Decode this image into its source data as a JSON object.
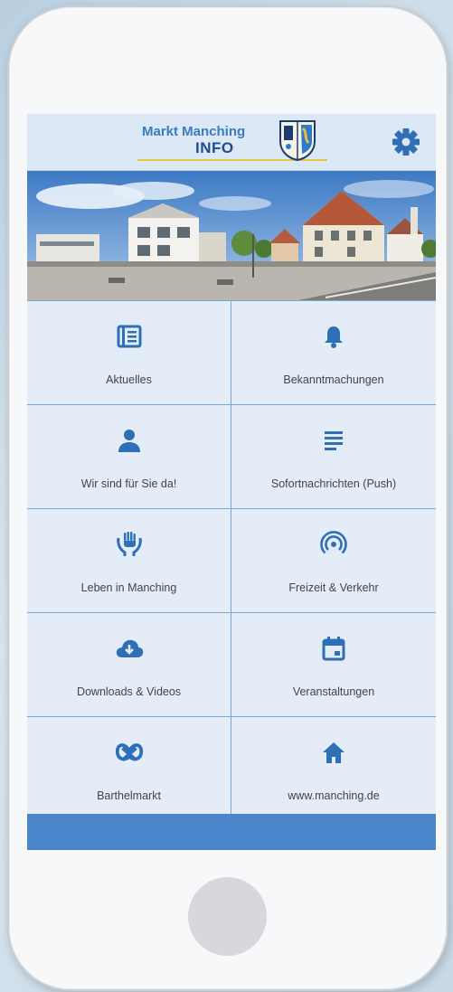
{
  "app": {
    "logo_line1": "Markt Manching",
    "logo_line2": "INFO"
  },
  "icons": {
    "settings": "gear-icon",
    "crest": "coat-of-arms-icon"
  },
  "colors": {
    "accent": "#2f6fb6",
    "tile_bg": "#e3ecf7",
    "divider": "#7aa6d3",
    "footer": "#4a86c9",
    "logo_underline": "#e2c64a"
  },
  "menu": [
    {
      "label": "Aktuelles",
      "icon": "newspaper-icon"
    },
    {
      "label": "Bekanntmachungen",
      "icon": "bell-icon"
    },
    {
      "label": "Wir sind für Sie da!",
      "icon": "person-icon"
    },
    {
      "label": "Sofortnachrichten (Push)",
      "icon": "text-lines-icon"
    },
    {
      "label": "Leben in Manching",
      "icon": "helping-hands-icon"
    },
    {
      "label": "Freizeit & Verkehr",
      "icon": "broadcast-icon"
    },
    {
      "label": "Downloads & Videos",
      "icon": "cloud-download-icon"
    },
    {
      "label": "Veranstaltungen",
      "icon": "calendar-icon"
    },
    {
      "label": "Barthelmarkt",
      "icon": "pretzel-icon"
    },
    {
      "label": "www.manching.de",
      "icon": "home-icon"
    }
  ]
}
